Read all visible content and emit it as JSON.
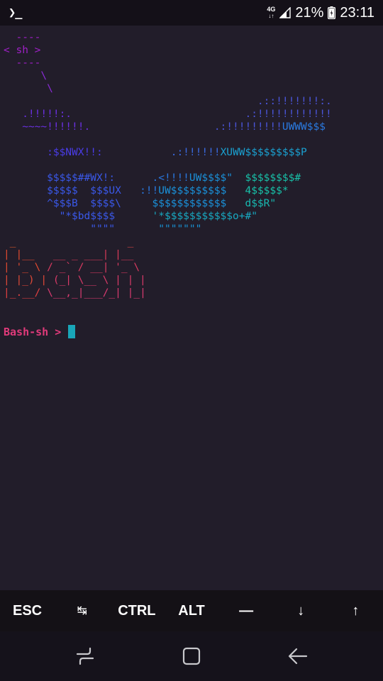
{
  "status_bar": {
    "app_icon": "terminal-icon",
    "network": "4G",
    "network_arrows": "↓↑",
    "battery": "21%",
    "time": "23:11"
  },
  "terminal": {
    "ascii_lines": [
      [
        [
          "  ----",
          "#a020c8"
        ]
      ],
      [
        [
          "< sh >",
          "#a020c8"
        ]
      ],
      [
        [
          "  ----",
          "#a020c8"
        ]
      ],
      [
        [
          "      \\",
          "#8a2bd8"
        ]
      ],
      [
        [
          "       \\",
          "#8a2bd8"
        ]
      ],
      [
        [
          "                                         .::!!!!!!!:.",
          "#4a55d8"
        ]
      ],
      [
        [
          "   .!!!!!:.",
          "#6a30e0"
        ],
        [
          "                            .:!!!!!!!!!!!!",
          "#4a55d8"
        ]
      ],
      [
        [
          "   ~~~~!!!!!!.",
          "#6a30e0"
        ],
        [
          "                    .:!!!!!!!!!",
          "#4a55d8"
        ],
        [
          "UWWW$$$",
          "#2a7ae0"
        ]
      ],
      [
        [
          " ",
          "#6a30e0"
        ]
      ],
      [
        [
          "       :$$NWX!!:",
          "#4a3ce8"
        ],
        [
          "           .:!!!!!!",
          "#3a6ae0"
        ],
        [
          "XUWW$$$$$$$$$P",
          "#1aa0d0"
        ]
      ],
      [
        [
          " ",
          "#6a30e0"
        ]
      ],
      [
        [
          "       $$$$$##WX!:",
          "#3a58e8"
        ],
        [
          "      .<!!!!",
          "#2a78e0"
        ],
        [
          "UW$$$$\"",
          "#1a90d8"
        ],
        [
          "  $$$$$$$$#",
          "#18c0a8"
        ]
      ],
      [
        [
          "       $$$$$  $$$UX",
          "#3a58e8"
        ],
        [
          "   :!!",
          "#2a78e0"
        ],
        [
          "UW$$$$$$$$$",
          "#1a90d8"
        ],
        [
          "   4$$$$$*",
          "#18c0a8"
        ]
      ],
      [
        [
          "       ^$$$B  $$$$\\",
          "#3a58e8"
        ],
        [
          "     $$$$$$$$$$$$",
          "#1a90d8"
        ],
        [
          "   d$$R\"",
          "#18b8b0"
        ]
      ],
      [
        [
          "         \"*$bd$$$$",
          "#3a58e8"
        ],
        [
          "      '*$$$$$$$$$$$o+#\"",
          "#18a8c0"
        ]
      ],
      [
        [
          "              \"\"\"\"",
          "#3a58e8"
        ],
        [
          "       \"\"\"\"\"\"\"",
          "#1890d0"
        ]
      ],
      [
        [
          " _",
          "#e05a28"
        ],
        [
          "                  _",
          "#e04a48"
        ]
      ],
      [
        [
          "| |__",
          "#e04a30"
        ],
        [
          "   __ _ ___| |__",
          "#d83a58"
        ]
      ],
      [
        [
          "| '_ \\",
          "#e04a30"
        ],
        [
          " / _` / __| '_ \\",
          "#d83a60"
        ]
      ],
      [
        [
          "| |_) |",
          "#e04a38"
        ],
        [
          " (_| \\__ \\ | | |",
          "#d83a68"
        ]
      ],
      [
        [
          "|_.__/",
          "#e04040"
        ],
        [
          " \\__,_|___/_| |_|",
          "#d83a70"
        ]
      ]
    ],
    "prompt": "Bash-sh > "
  },
  "extra_keys": [
    "ESC",
    "↹",
    "CTRL",
    "ALT",
    "—",
    "↓",
    "↑"
  ],
  "nav": {
    "recents_icon": "recents-icon",
    "home_icon": "home-icon",
    "back_icon": "back-icon"
  }
}
